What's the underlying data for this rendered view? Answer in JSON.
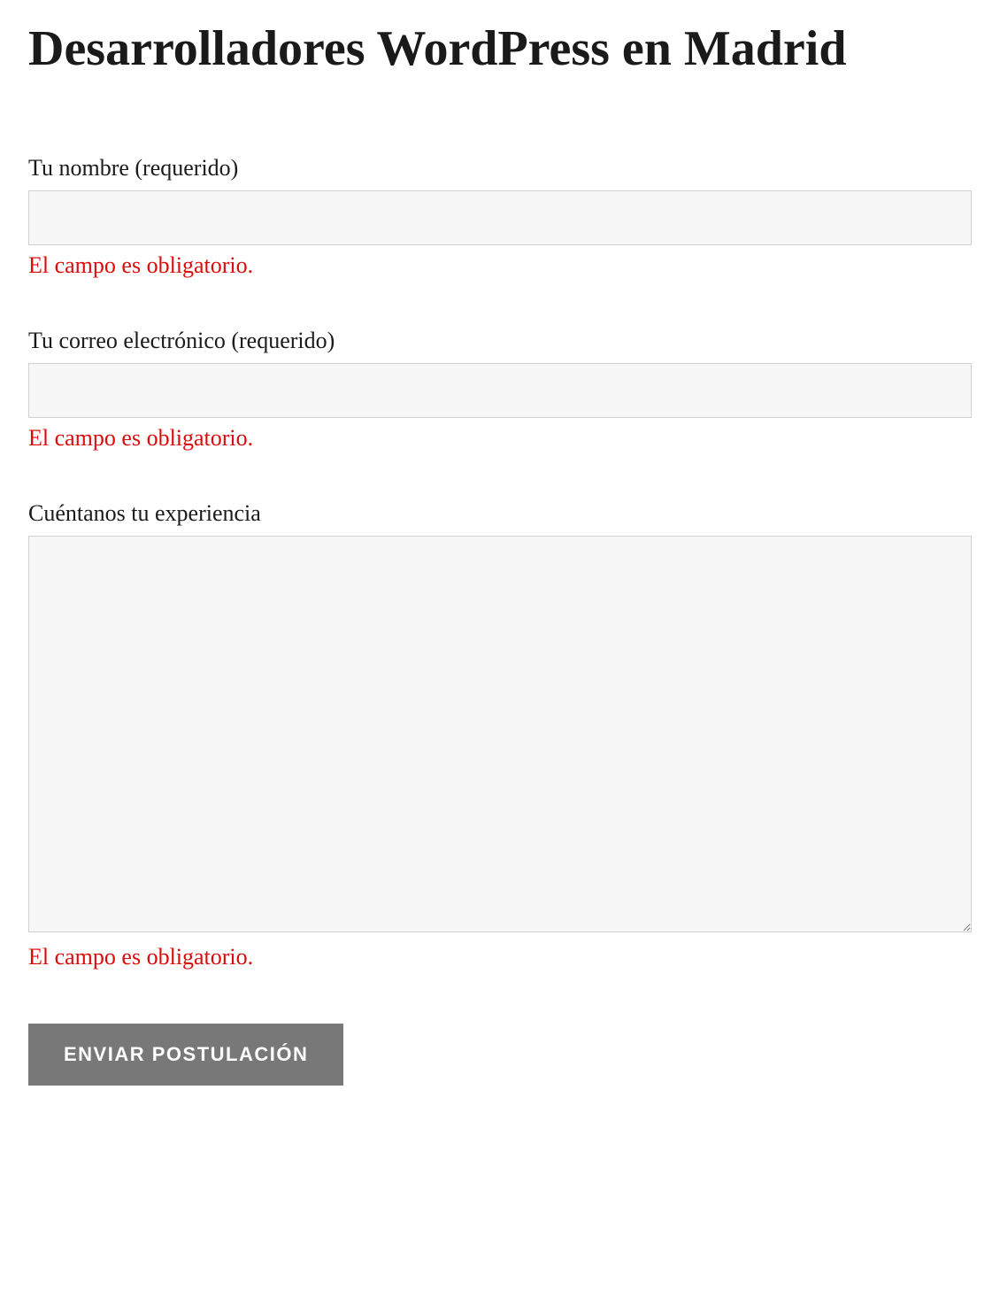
{
  "title": "Desarrolladores WordPress en Madrid",
  "form": {
    "name": {
      "label": "Tu nombre (requerido)",
      "value": "",
      "error": "El campo es obligatorio."
    },
    "email": {
      "label": "Tu correo electrónico (requerido)",
      "value": "",
      "error": "El campo es obligatorio."
    },
    "experience": {
      "label": "Cuéntanos tu experiencia",
      "value": "",
      "error": "El campo es obligatorio."
    },
    "submit_label": "ENVIAR POSTULACIÓN"
  }
}
